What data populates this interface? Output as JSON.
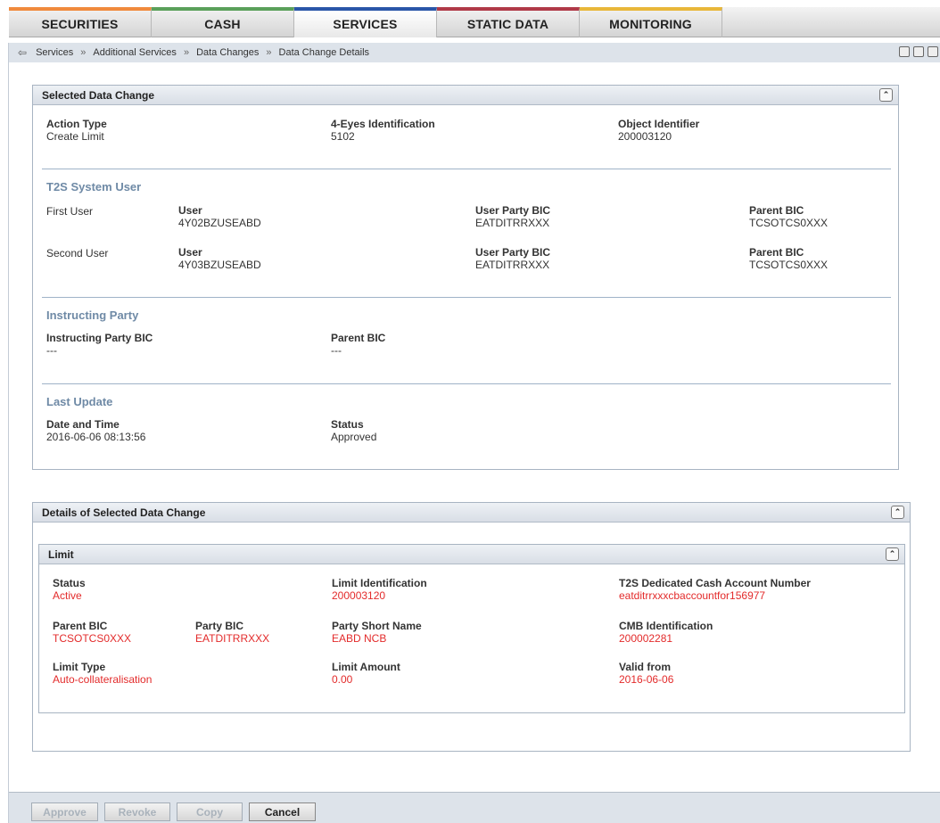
{
  "nav": {
    "tabs": [
      {
        "label": "SECURITIES",
        "color": "#f08a3c"
      },
      {
        "label": "CASH",
        "color": "#5aa05a"
      },
      {
        "label": "SERVICES",
        "color": "#2a56a8"
      },
      {
        "label": "STATIC DATA",
        "color": "#b03a48"
      },
      {
        "label": "MONITORING",
        "color": "#e8b73a"
      }
    ],
    "active": "SERVICES"
  },
  "breadcrumb": {
    "back_icon": "back-arrow-icon",
    "items": [
      "Services",
      "Additional Services",
      "Data Changes",
      "Data Change Details"
    ],
    "separator": "»"
  },
  "selected": {
    "title": "Selected Data Change",
    "action_type": {
      "label": "Action Type",
      "value": "Create Limit"
    },
    "four_eyes": {
      "label": "4-Eyes Identification",
      "value": "5102"
    },
    "object_id": {
      "label": "Object Identifier",
      "value": "200003120"
    },
    "t2s_title": "T2S System User",
    "first_user": {
      "name": "First User",
      "user_label": "User",
      "user": "4Y02BZUSEABD",
      "bic_label": "User Party BIC",
      "bic": "EATDITRRXXX",
      "parent_label": "Parent BIC",
      "parent": "TCSOTCS0XXX"
    },
    "second_user": {
      "name": "Second User",
      "user_label": "User",
      "user": "4Y03BZUSEABD",
      "bic_label": "User Party BIC",
      "bic": "EATDITRRXXX",
      "parent_label": "Parent BIC",
      "parent": "TCSOTCS0XXX"
    },
    "instructing_title": "Instructing Party",
    "instructing_bic": {
      "label": "Instructing Party BIC",
      "value": "---"
    },
    "instructing_parent": {
      "label": "Parent BIC",
      "value": "---"
    },
    "last_update_title": "Last Update",
    "date_time": {
      "label": "Date and Time",
      "value": "2016-06-06 08:13:56"
    },
    "status": {
      "label": "Status",
      "value": "Approved"
    }
  },
  "details": {
    "title": "Details of Selected Data Change",
    "limit_title": "Limit",
    "status": {
      "label": "Status",
      "value": "Active"
    },
    "limit_id": {
      "label": "Limit Identification",
      "value": "200003120"
    },
    "cash_account": {
      "label": "T2S Dedicated Cash Account Number",
      "value": "eatditrrxxxcbaccountfor156977"
    },
    "parent_bic": {
      "label": "Parent BIC",
      "value": "TCSOTCS0XXX"
    },
    "party_bic": {
      "label": "Party BIC",
      "value": "EATDITRRXXX"
    },
    "party_short": {
      "label": "Party Short Name",
      "value": "EABD NCB"
    },
    "cmb_id": {
      "label": "CMB Identification",
      "value": "200002281"
    },
    "limit_type": {
      "label": "Limit Type",
      "value": "Auto-collateralisation"
    },
    "limit_amount": {
      "label": "Limit Amount",
      "value": "0.00"
    },
    "valid_from": {
      "label": "Valid from",
      "value": "2016-06-06"
    },
    "changed_color": "#e32b2b"
  },
  "buttons": {
    "approve": "Approve",
    "revoke": "Revoke",
    "copy": "Copy",
    "cancel": "Cancel"
  }
}
